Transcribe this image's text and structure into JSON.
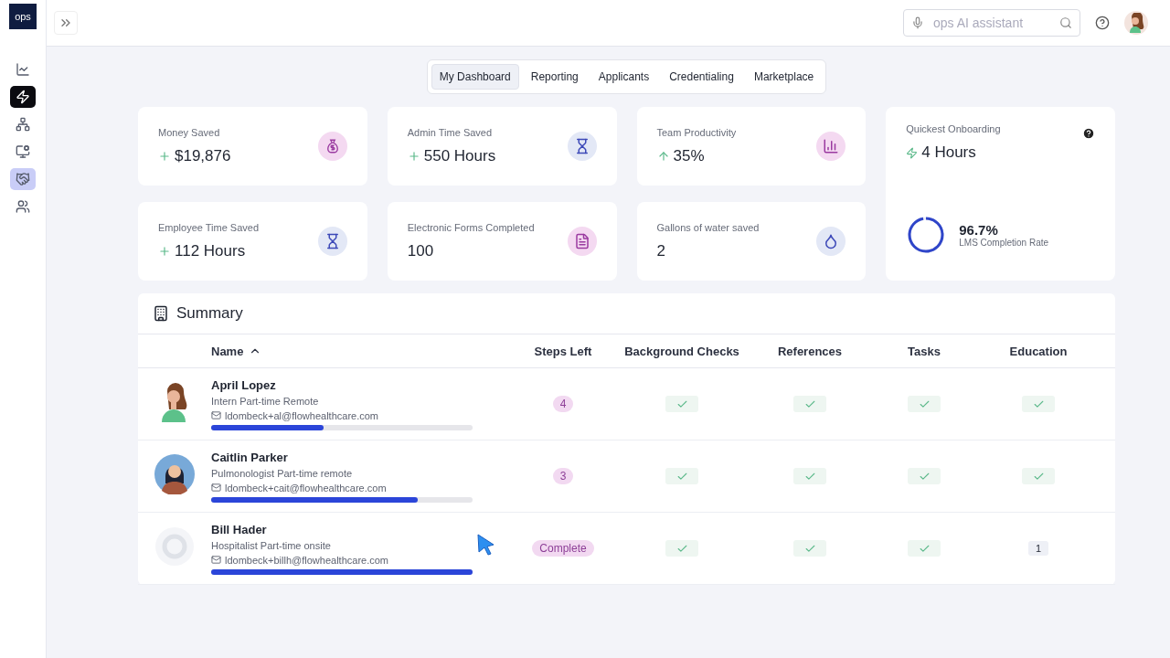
{
  "logo": "ops",
  "sidebar": {
    "items": [
      {
        "selected": false,
        "highlighted": false
      },
      {
        "selected": true,
        "highlighted": false
      },
      {
        "selected": false,
        "highlighted": false
      },
      {
        "selected": false,
        "highlighted": false
      },
      {
        "selected": false,
        "highlighted": true
      },
      {
        "selected": false,
        "highlighted": false
      }
    ]
  },
  "search": {
    "placeholder": "ops AI assistant"
  },
  "tabs": [
    {
      "label": "My Dashboard",
      "selected": true
    },
    {
      "label": "Reporting",
      "selected": false
    },
    {
      "label": "Applicants",
      "selected": false
    },
    {
      "label": "Credentialing",
      "selected": false
    },
    {
      "label": "Marketplace",
      "selected": false
    }
  ],
  "stats": [
    {
      "label": "Money Saved",
      "value": "$19,876",
      "kind": "plus"
    },
    {
      "label": "Admin Time Saved",
      "value": "550 Hours",
      "kind": "plus"
    },
    {
      "label": "Team Productivity",
      "value": "35%",
      "kind": "up"
    },
    {
      "label": "Employee Time Saved",
      "value": "112 Hours",
      "kind": "plus"
    },
    {
      "label": "Electronic Forms Completed",
      "value": "100",
      "kind": "none"
    },
    {
      "label": "Gallons of water saved",
      "value": "2",
      "kind": "none"
    }
  ],
  "onboarding": {
    "label": "Quickest Onboarding",
    "value": "4 Hours",
    "level": 0.967,
    "reading": "96.7%",
    "caption": "LMS Completion Rate"
  },
  "summary": {
    "title": "Summary",
    "columns": [
      "Name",
      "Steps Left",
      "Background Checks",
      "References",
      "Tasks",
      "Education"
    ],
    "rows": [
      {
        "cells": [
          {
            "kind": "figure",
            "name": "April Lopez",
            "role": "Intern Part-time Remote",
            "email": "ldombeck+al@flowhealthcare.com",
            "level": 0.43
          },
          {
            "kind": "badge",
            "text": "4"
          },
          {
            "kind": "check"
          },
          {
            "kind": "check"
          },
          {
            "kind": "check"
          },
          {
            "kind": "check"
          }
        ]
      },
      {
        "cells": [
          {
            "kind": "portrait",
            "name": "Caitlin Parker",
            "role": "Pulmonologist Part-time remote",
            "email": "ldombeck+cait@flowhealthcare.com",
            "level": 0.79
          },
          {
            "kind": "badge",
            "text": "3"
          },
          {
            "kind": "check"
          },
          {
            "kind": "check"
          },
          {
            "kind": "check"
          },
          {
            "kind": "check"
          }
        ]
      },
      {
        "cells": [
          {
            "kind": "placeholder",
            "name": "Bill Hader",
            "role": "Hospitalist Part-time onsite",
            "email": "ldombeck+billh@flowhealthcare.com",
            "level": 1
          },
          {
            "kind": "badge",
            "text": "Complete"
          },
          {
            "kind": "check"
          },
          {
            "kind": "check"
          },
          {
            "kind": "check"
          },
          {
            "kind": "count",
            "text": "1"
          }
        ]
      }
    ]
  }
}
